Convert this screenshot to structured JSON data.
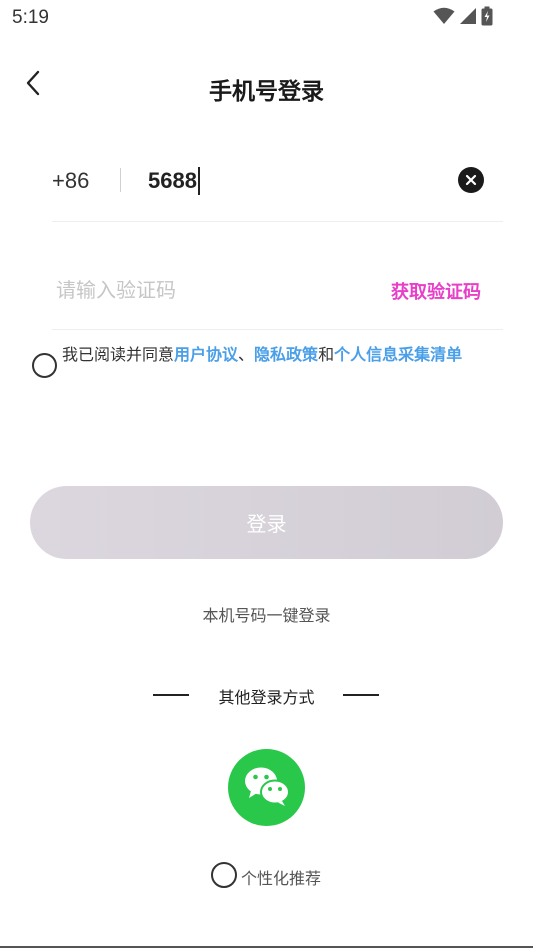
{
  "status_bar": {
    "time": "5:19",
    "icons": [
      "wifi-icon",
      "signal-icon",
      "battery-charging-icon"
    ]
  },
  "header": {
    "back_icon": "chevron-left-icon",
    "title": "手机号登录"
  },
  "phone": {
    "country_code": "+86",
    "value": "5688",
    "clear_icon": "clear-circle-icon"
  },
  "verification": {
    "placeholder": "请输入验证码",
    "get_code_label": "获取验证码"
  },
  "agreement": {
    "prefix": "我已阅读并同意",
    "link_user_agreement": "用户协议",
    "sep": "、",
    "link_privacy": "隐私政策",
    "and": "和",
    "link_info_list": "个人信息采集清单"
  },
  "login": {
    "button_label": "登录",
    "one_click_label": "本机号码一键登录"
  },
  "other": {
    "label": "其他登录方式",
    "wechat_icon": "wechat-icon"
  },
  "personal": {
    "label": "个性化推荐"
  },
  "colors": {
    "accent_pink": "#e83fc8",
    "link_blue": "#4a9fe8",
    "wechat_green": "#2ac84a",
    "disabled_button": "#d6d1d9"
  }
}
